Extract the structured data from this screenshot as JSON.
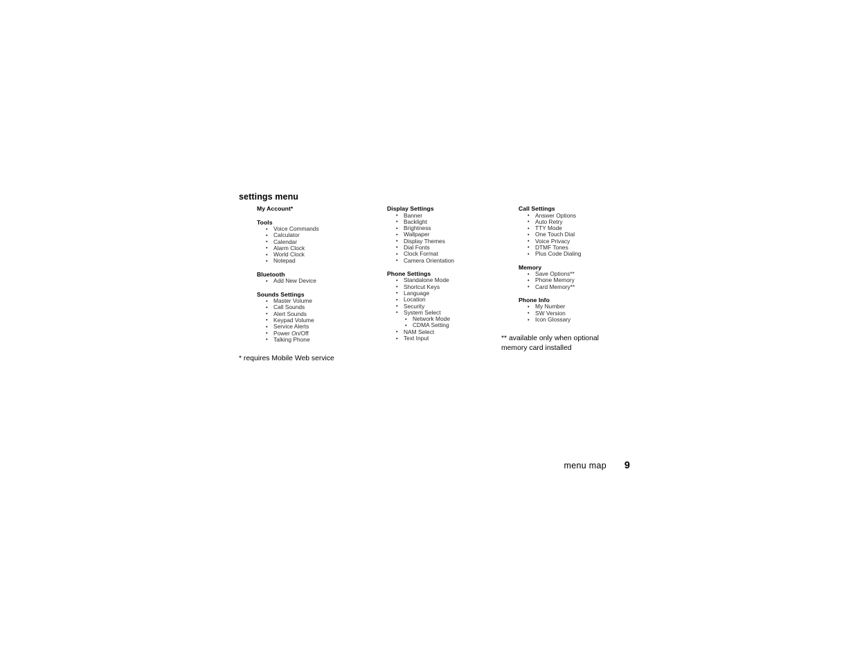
{
  "page": {
    "section_title": "settings menu",
    "footer_label": "menu map",
    "footer_page_number": "9"
  },
  "columns": [
    {
      "id": "column-1",
      "groups": [
        {
          "heading": "My Account*",
          "items": []
        },
        {
          "heading": "Tools",
          "items": [
            {
              "label": "Voice Commands"
            },
            {
              "label": "Calculator"
            },
            {
              "label": "Calendar"
            },
            {
              "label": "Alarm Clock"
            },
            {
              "label": "World Clock"
            },
            {
              "label": "Notepad"
            }
          ]
        },
        {
          "heading": "Bluetooth",
          "items": [
            {
              "label": "Add New Device"
            }
          ]
        },
        {
          "heading": "Sounds Settings",
          "items": [
            {
              "label": "Master Volume"
            },
            {
              "label": "Call Sounds"
            },
            {
              "label": "Alert Sounds"
            },
            {
              "label": "Keypad Volume"
            },
            {
              "label": "Service Alerts"
            },
            {
              "label": "Power On/Off"
            },
            {
              "label": "Talking Phone"
            }
          ]
        }
      ]
    },
    {
      "id": "column-2",
      "groups": [
        {
          "heading": "Display Settings",
          "items": [
            {
              "label": "Banner"
            },
            {
              "label": "Backlight"
            },
            {
              "label": "Brightness"
            },
            {
              "label": "Wallpaper"
            },
            {
              "label": "Display Themes"
            },
            {
              "label": "Dial Fonts"
            },
            {
              "label": "Clock Format"
            },
            {
              "label": "Camera Orientation"
            }
          ]
        },
        {
          "heading": "Phone Settings",
          "items": [
            {
              "label": "Standalone Mode"
            },
            {
              "label": "Shortcut Keys"
            },
            {
              "label": "Language"
            },
            {
              "label": "Location"
            },
            {
              "label": "Security"
            },
            {
              "label": "System Select",
              "subitems": [
                {
                  "label": "Network Mode"
                },
                {
                  "label": "CDMA Setting"
                }
              ]
            },
            {
              "label": "NAM Select"
            },
            {
              "label": "Text Input"
            }
          ]
        }
      ]
    },
    {
      "id": "column-3",
      "groups": [
        {
          "heading": "Call Settings",
          "items": [
            {
              "label": "Answer Options"
            },
            {
              "label": "Auto Retry"
            },
            {
              "label": "TTY Mode"
            },
            {
              "label": "One Touch Dial"
            },
            {
              "label": "Voice Privacy"
            },
            {
              "label": "DTMF Tones"
            },
            {
              "label": "Plus Code Dialing"
            }
          ]
        },
        {
          "heading": "Memory",
          "items": [
            {
              "label": "Save Options**"
            },
            {
              "label": "Phone Memory"
            },
            {
              "label": "Card Memory**"
            }
          ]
        },
        {
          "heading": "Phone Info",
          "items": [
            {
              "label": "My Number"
            },
            {
              "label": "SW Version"
            },
            {
              "label": "Icon Glossary"
            }
          ]
        }
      ]
    }
  ],
  "footnotes": [
    {
      "id": "footnote-single-asterisk",
      "text": "* requires Mobile Web service"
    },
    {
      "id": "footnote-double-asterisk",
      "text": "** available only when optional memory card installed"
    }
  ]
}
